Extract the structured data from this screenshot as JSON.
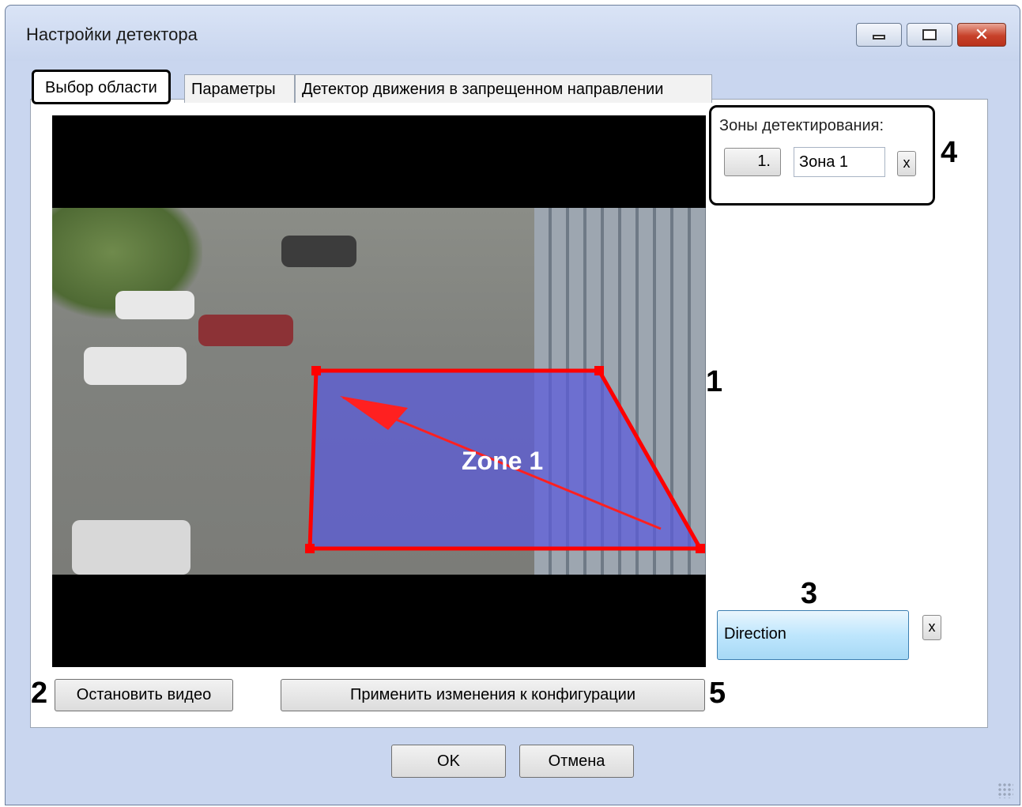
{
  "window": {
    "title": "Настройки детектора",
    "controls": [
      "minimize-icon",
      "maximize-icon",
      "close-icon"
    ],
    "close_glyph": "✕"
  },
  "tabs": [
    {
      "label": "Выбор области",
      "active": true
    },
    {
      "label": "Параметры",
      "active": false
    },
    {
      "label": "Детектор движения в запрещенном направлении",
      "active": false
    }
  ],
  "video": {
    "overlay_label": "Zone 1",
    "zone_color": "#ff0000",
    "zone_fill": "#5a5adc"
  },
  "zones": {
    "label": "Зоны детектирования:",
    "items": [
      {
        "number": "1.",
        "name": "Зона 1",
        "delete_label": "x"
      }
    ]
  },
  "direction": {
    "label": "Direction",
    "delete_label": "x"
  },
  "markers": [
    "1",
    "2",
    "3",
    "4",
    "5"
  ],
  "buttons": {
    "stop_video": "Остановить видео",
    "apply": "Применить изменения к конфигурации",
    "ok": "OK",
    "cancel": "Отмена"
  }
}
